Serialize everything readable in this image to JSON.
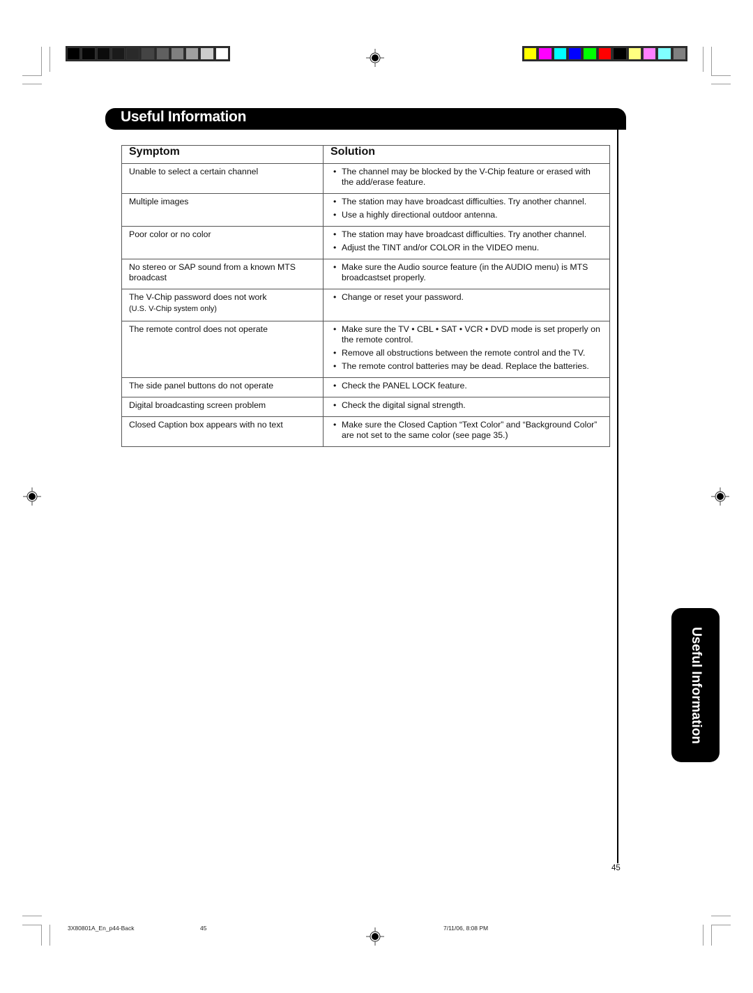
{
  "print_marks": {
    "grayscale_bar": [
      "#000000",
      "#050505",
      "#0c0c0c",
      "#1a1a1a",
      "#2a2a2a",
      "#444444",
      "#606060",
      "#808080",
      "#a0a0a0",
      "#cccccc",
      "#ffffff"
    ],
    "color_bar": [
      "#ffff00",
      "#ff00ff",
      "#00ffff",
      "#0000ff",
      "#00ff00",
      "#ff0000",
      "#000000",
      "#ffff80",
      "#ff80ff",
      "#80ffff",
      "#808080"
    ]
  },
  "header": {
    "title": "Useful Information"
  },
  "table": {
    "columns": [
      "Symptom",
      "Solution"
    ],
    "rows": [
      {
        "symptom": "Unable to select a certain channel",
        "note": "",
        "solutions": [
          "The channel may be blocked by the V-Chip feature or erased with the add/erase feature."
        ]
      },
      {
        "symptom": "Multiple images",
        "note": "",
        "solutions": [
          "The station may have broadcast difficulties. Try another channel.",
          "Use a highly directional outdoor antenna."
        ]
      },
      {
        "symptom": "Poor color or no color",
        "note": "",
        "solutions": [
          "The station may have broadcast difficulties. Try another channel.",
          "Adjust the TINT and/or COLOR in the VIDEO menu."
        ]
      },
      {
        "symptom": "No stereo or SAP sound from a known MTS broadcast",
        "note": "",
        "solutions": [
          "Make sure the Audio source feature (in the AUDIO menu) is MTS broadcastset properly."
        ]
      },
      {
        "symptom": "The V-Chip password does not work",
        "note": "(U.S. V-Chip system only)",
        "solutions": [
          "Change or reset your password."
        ]
      },
      {
        "symptom": "The remote control does not operate",
        "note": "",
        "solutions": [
          "Make sure the TV • CBL • SAT • VCR • DVD mode is set properly on the remote control.",
          "Remove all obstructions between the remote control and the TV.",
          "The remote control batteries may be dead. Replace the batteries."
        ]
      },
      {
        "symptom": "The side panel buttons do not operate",
        "note": "",
        "solutions": [
          "Check the PANEL LOCK feature."
        ]
      },
      {
        "symptom": "Digital broadcasting screen problem",
        "note": "",
        "solutions": [
          "Check the digital signal strength."
        ]
      },
      {
        "symptom": "Closed Caption box appears with no text",
        "note": "",
        "solutions": [
          "Make sure the Closed Caption “Text Color” and “Background Color” are not set to the same color (see page 35.)"
        ]
      }
    ]
  },
  "side_tab": {
    "label": "Useful Information"
  },
  "page_number": "45",
  "footer": {
    "file_name": "3X80801A_En_p44-Back",
    "page": "45",
    "timestamp": "7/11/06, 8:08 PM"
  }
}
